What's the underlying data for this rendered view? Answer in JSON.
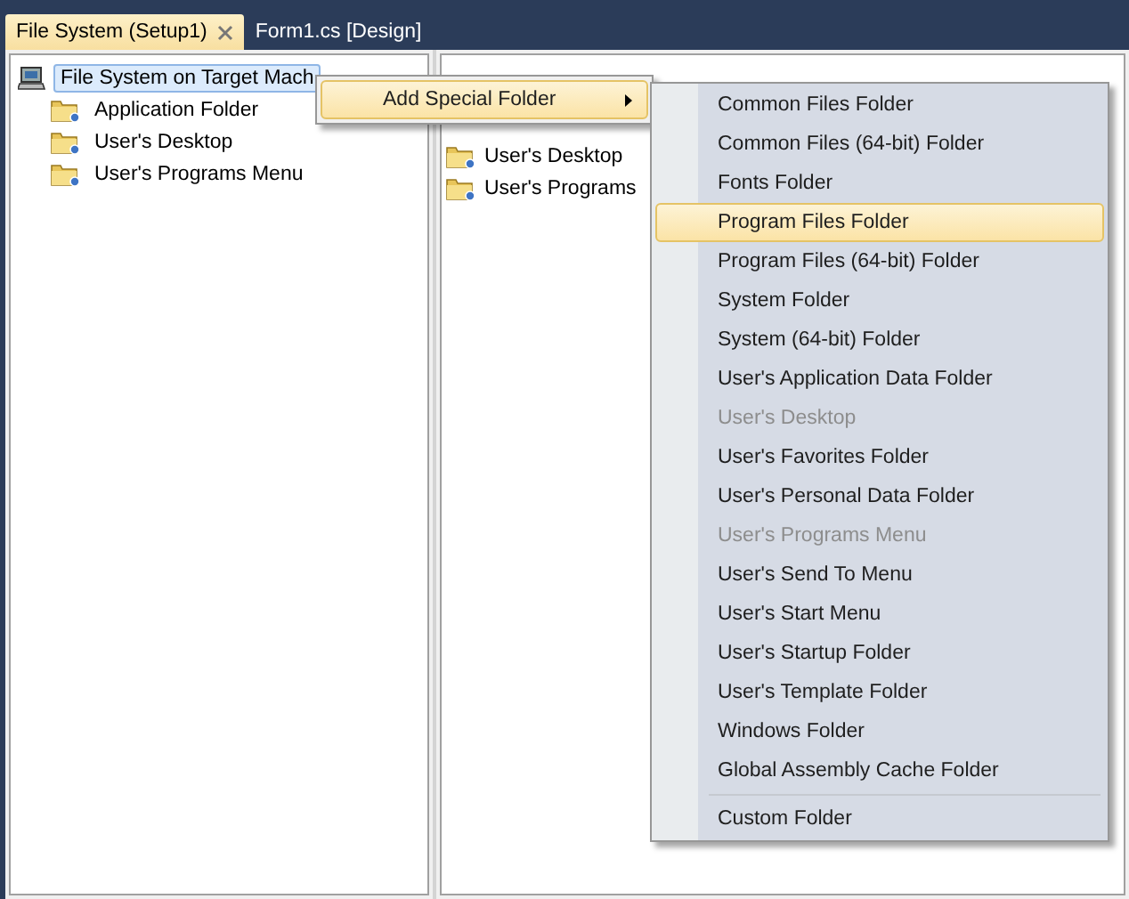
{
  "tabs": [
    {
      "label": "File System (Setup1)",
      "selected": true,
      "closable": true
    },
    {
      "label": "Form1.cs [Design]",
      "selected": false,
      "closable": false
    }
  ],
  "tree": {
    "label": "File System on Target Mach",
    "selected": true,
    "children": [
      {
        "label": "Application Folder"
      },
      {
        "label": "User's Desktop"
      },
      {
        "label": "User's Programs Menu"
      }
    ]
  },
  "list": {
    "items": [
      {
        "label": "User's Desktop"
      },
      {
        "label": "User's Programs"
      }
    ]
  },
  "context_menu": {
    "items": [
      {
        "label": "Add Special Folder",
        "selected": true,
        "submenu": true
      }
    ]
  },
  "submenu": {
    "items": [
      {
        "kind": "item",
        "label": "Common Files Folder",
        "selected": false,
        "disabled": false
      },
      {
        "kind": "item",
        "label": "Common Files (64-bit) Folder",
        "selected": false,
        "disabled": false
      },
      {
        "kind": "item",
        "label": "Fonts Folder",
        "selected": false,
        "disabled": false
      },
      {
        "kind": "item",
        "label": "Program Files Folder",
        "selected": true,
        "disabled": false
      },
      {
        "kind": "item",
        "label": "Program Files (64-bit) Folder",
        "selected": false,
        "disabled": false
      },
      {
        "kind": "item",
        "label": "System Folder",
        "selected": false,
        "disabled": false
      },
      {
        "kind": "item",
        "label": "System (64-bit) Folder",
        "selected": false,
        "disabled": false
      },
      {
        "kind": "item",
        "label": "User's Application Data Folder",
        "selected": false,
        "disabled": false
      },
      {
        "kind": "item",
        "label": "User's Desktop",
        "selected": false,
        "disabled": true
      },
      {
        "kind": "item",
        "label": "User's Favorites Folder",
        "selected": false,
        "disabled": false
      },
      {
        "kind": "item",
        "label": "User's Personal Data Folder",
        "selected": false,
        "disabled": false
      },
      {
        "kind": "item",
        "label": "User's Programs Menu",
        "selected": false,
        "disabled": true
      },
      {
        "kind": "item",
        "label": "User's Send To Menu",
        "selected": false,
        "disabled": false
      },
      {
        "kind": "item",
        "label": "User's Start Menu",
        "selected": false,
        "disabled": false
      },
      {
        "kind": "item",
        "label": "User's Startup Folder",
        "selected": false,
        "disabled": false
      },
      {
        "kind": "item",
        "label": "User's Template Folder",
        "selected": false,
        "disabled": false
      },
      {
        "kind": "item",
        "label": "Windows Folder",
        "selected": false,
        "disabled": false
      },
      {
        "kind": "item",
        "label": "Global Assembly Cache Folder",
        "selected": false,
        "disabled": false
      },
      {
        "kind": "separator"
      },
      {
        "kind": "item",
        "label": "Custom Folder",
        "selected": false,
        "disabled": false
      }
    ]
  }
}
